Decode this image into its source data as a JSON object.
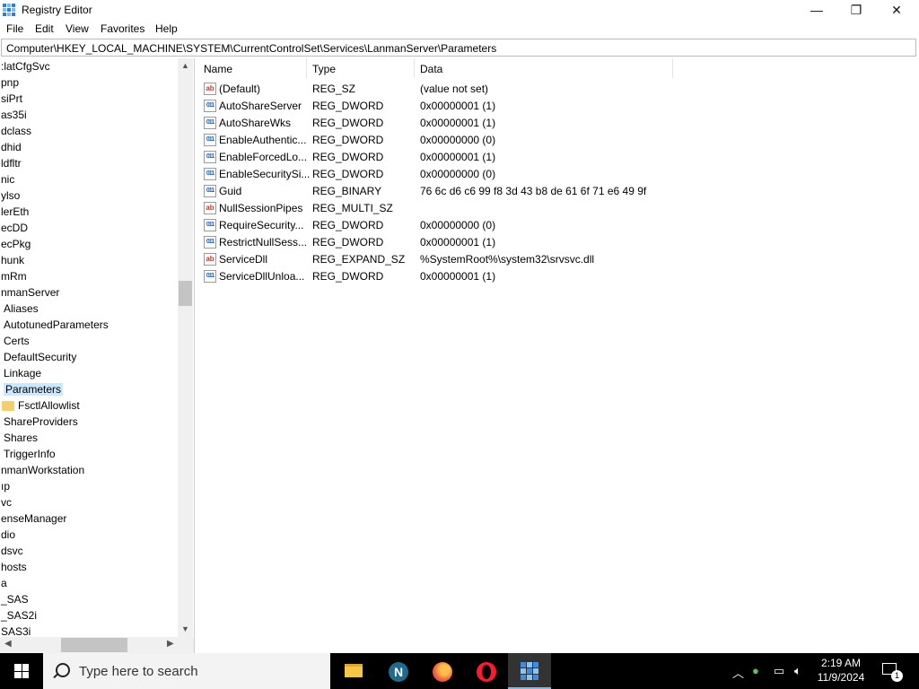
{
  "window": {
    "title": "Registry Editor",
    "minimize": "—",
    "maximize": "❐",
    "close": "✕"
  },
  "menu": [
    "File",
    "Edit",
    "View",
    "Favorites",
    "Help"
  ],
  "address": "Computer\\HKEY_LOCAL_MACHINE\\SYSTEM\\CurrentControlSet\\Services\\LanmanServer\\Parameters",
  "tree": {
    "items": [
      {
        "label": ":latCfgSvc"
      },
      {
        "label": "pnp"
      },
      {
        "label": "siPrt"
      },
      {
        "label": "as35i"
      },
      {
        "label": "dclass"
      },
      {
        "label": "dhid"
      },
      {
        "label": "ldfltr"
      },
      {
        "label": "nic"
      },
      {
        "label": "ylso"
      },
      {
        "label": "lerEth"
      },
      {
        "label": "ecDD"
      },
      {
        "label": "ecPkg"
      },
      {
        "label": "hunk"
      },
      {
        "label": "mRm"
      },
      {
        "label": "nmanServer"
      },
      {
        "label": "Aliases"
      },
      {
        "label": "AutotunedParameters"
      },
      {
        "label": "Certs"
      },
      {
        "label": "DefaultSecurity"
      },
      {
        "label": "Linkage"
      },
      {
        "label": "Parameters",
        "selected": true
      },
      {
        "label": "FsctlAllowlist",
        "folder": true
      },
      {
        "label": "ShareProviders"
      },
      {
        "label": "Shares"
      },
      {
        "label": "TriggerInfo"
      },
      {
        "label": "nmanWorkstation"
      },
      {
        "label": "ıp"
      },
      {
        "label": "vc"
      },
      {
        "label": "enseManager"
      },
      {
        "label": "dio"
      },
      {
        "label": "dsvc"
      },
      {
        "label": "hosts"
      },
      {
        "label": "a"
      },
      {
        "label": "_SAS"
      },
      {
        "label": "_SAS2i"
      },
      {
        "label": "SAS3i"
      }
    ]
  },
  "list": {
    "columns": [
      "Name",
      "Type",
      "Data"
    ],
    "rows": [
      {
        "icon": "ab",
        "name": "(Default)",
        "type": "REG_SZ",
        "data": "(value not set)"
      },
      {
        "icon": "bin",
        "name": "AutoShareServer",
        "type": "REG_DWORD",
        "data": "0x00000001 (1)"
      },
      {
        "icon": "bin",
        "name": "AutoShareWks",
        "type": "REG_DWORD",
        "data": "0x00000001 (1)"
      },
      {
        "icon": "bin",
        "name": "EnableAuthentic...",
        "type": "REG_DWORD",
        "data": "0x00000000 (0)"
      },
      {
        "icon": "bin",
        "name": "EnableForcedLo...",
        "type": "REG_DWORD",
        "data": "0x00000001 (1)"
      },
      {
        "icon": "bin",
        "name": "EnableSecuritySi...",
        "type": "REG_DWORD",
        "data": "0x00000000 (0)"
      },
      {
        "icon": "bin",
        "name": "Guid",
        "type": "REG_BINARY",
        "data": "76 6c d6 c6 99 f8 3d 43 b8 de 61 6f 71 e6 49 9f"
      },
      {
        "icon": "ab",
        "name": "NullSessionPipes",
        "type": "REG_MULTI_SZ",
        "data": ""
      },
      {
        "icon": "bin",
        "name": "RequireSecurity...",
        "type": "REG_DWORD",
        "data": "0x00000000 (0)"
      },
      {
        "icon": "bin",
        "name": "RestrictNullSess...",
        "type": "REG_DWORD",
        "data": "0x00000001 (1)"
      },
      {
        "icon": "ab",
        "name": "ServiceDll",
        "type": "REG_EXPAND_SZ",
        "data": "%SystemRoot%\\system32\\srvsvc.dll"
      },
      {
        "icon": "bin",
        "name": "ServiceDllUnloa...",
        "type": "REG_DWORD",
        "data": "0x00000001 (1)"
      }
    ]
  },
  "taskbar": {
    "search_placeholder": "Type here to search",
    "apps": [
      "file-explorer",
      "n-app",
      "firefox",
      "opera",
      "registry-editor"
    ],
    "time": "2:19 AM",
    "date": "11/9/2024",
    "notification_count": "1"
  }
}
